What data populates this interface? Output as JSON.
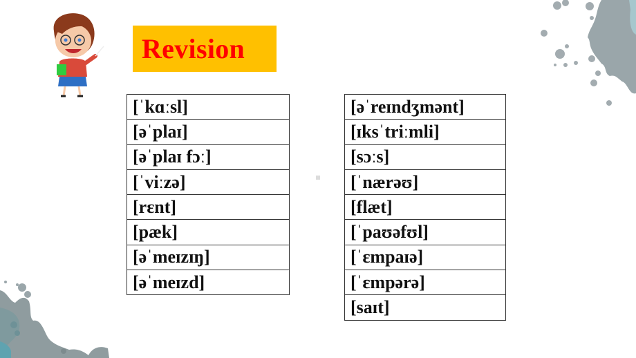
{
  "slide": {
    "title": "Revision",
    "colors": {
      "title_bg": "#ffc000",
      "title_text": "#ff0000",
      "splash": "#8fa0a6",
      "splash_teal": "#5fa3b0"
    },
    "illustration": "teacher-cartoon",
    "left_column": [
      "[ˈkɑːsl]",
      "[əˈplaɪ]",
      "[əˈplaɪ fɔː]",
      "[ˈviːzə]",
      "[rɛnt]",
      "[pæk]",
      "[əˈmeɪzɪŋ]",
      "[əˈmeɪzd]"
    ],
    "right_column": [
      "[əˈreɪndʒmənt]",
      "[ɪksˈtriːmli]",
      "[sɔːs]",
      "[ˈnærəʊ]",
      "[flæt]",
      "[ˈpaʊəfʊl]",
      "[ˈɛmpaɪə]",
      "[ˈɛmpərə]",
      "[saɪt]"
    ]
  }
}
